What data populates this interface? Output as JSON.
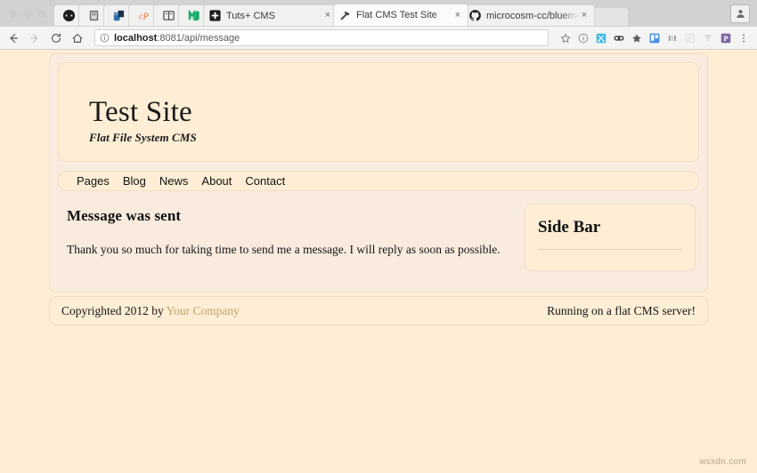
{
  "browser": {
    "window_dots": 3,
    "pinned_tabs": [
      {
        "name": "pinned-tab-1",
        "icon": "circle-dark-icon"
      },
      {
        "name": "pinned-tab-2",
        "icon": "book-grey-icon"
      },
      {
        "name": "pinned-tab-3",
        "icon": "blue-block-icon"
      },
      {
        "name": "pinned-tab-4",
        "icon": "cp-orange-icon"
      },
      {
        "name": "pinned-tab-5",
        "icon": "open-book-icon"
      },
      {
        "name": "pinned-tab-6",
        "icon": "green-m-icon"
      }
    ],
    "tabs": [
      {
        "title": "Tuts+ CMS",
        "icon": "plus-square-icon",
        "active": false,
        "close_label": "×"
      },
      {
        "title": "Flat CMS Test Site",
        "icon": "hammer-icon",
        "active": true,
        "close_label": "×"
      },
      {
        "title": "microcosm-cc/bluemonday: b",
        "icon": "github-icon",
        "active": false,
        "close_label": "×"
      }
    ],
    "toolbar": {
      "back_icon": "back-arrow-icon",
      "forward_icon": "forward-arrow-icon",
      "reload_icon": "reload-icon",
      "home_icon": "home-icon",
      "info_icon": "page-info-icon",
      "url_host": "localhost",
      "url_path": ":8081/api/message",
      "url_full": "localhost:8081/api/message",
      "bookmark_icon": "star-outline-icon",
      "menu_icon": "kebab-menu-icon",
      "extensions": [
        "info-circle-icon",
        "scissors-blue-icon",
        "goggles-icon",
        "star-icon",
        "trello-icon",
        "bars-icon",
        "list-faded-icon",
        "filter-faded-icon",
        "pocket-icon"
      ]
    },
    "profile_icon": "person-icon"
  },
  "site": {
    "title": "Test Site",
    "tagline": "Flat File System CMS",
    "nav": [
      {
        "label": "Pages"
      },
      {
        "label": "Blog"
      },
      {
        "label": "News"
      },
      {
        "label": "About"
      },
      {
        "label": "Contact"
      }
    ],
    "main": {
      "heading": "Message was sent",
      "body": "Thank you so much for taking time to send me a message. I will reply as soon as possible."
    },
    "sidebar": {
      "heading": "Side Bar"
    },
    "footer": {
      "copyright_prefix": "Copyrighted 2012 by ",
      "company_link": "Your Company",
      "right_text": "Running on a flat CMS server!"
    },
    "colors": {
      "page_background": "#fdeed5",
      "panel_background": "#f9ecdf",
      "border": "#f0dcc2",
      "link": "#c6a169",
      "text": "#151515"
    }
  },
  "watermark": "wsxdn.com"
}
